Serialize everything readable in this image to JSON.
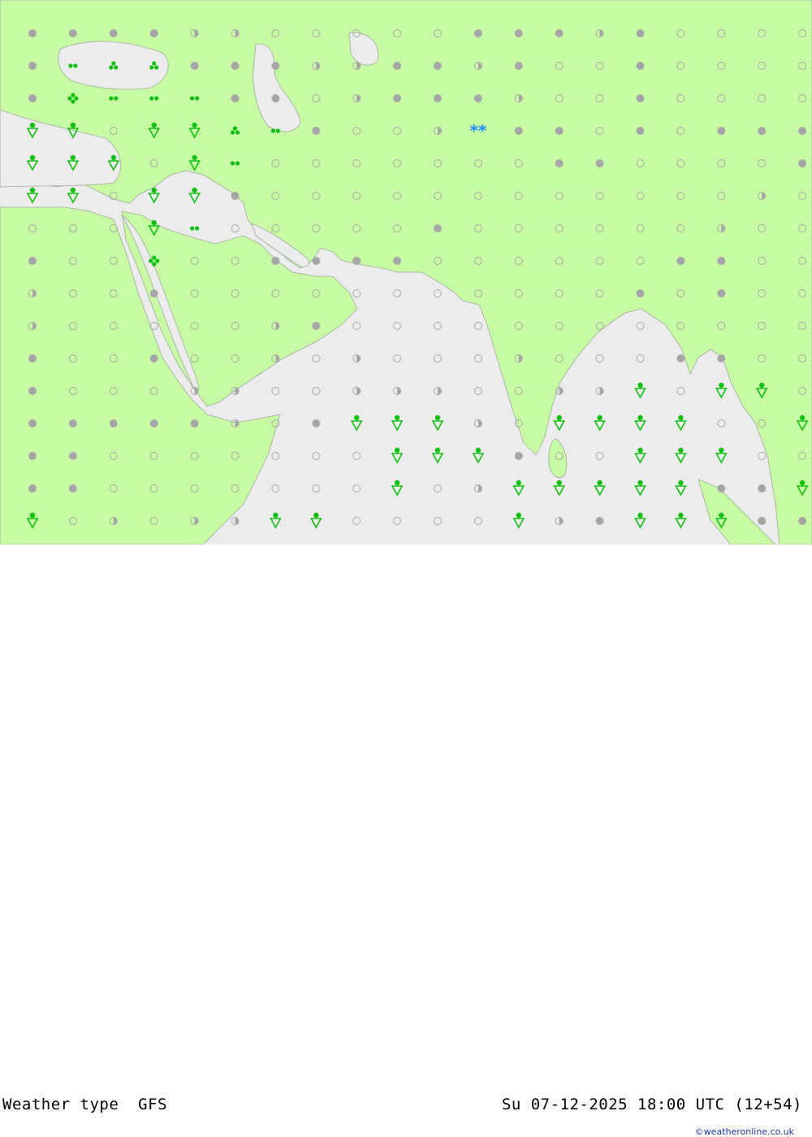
{
  "footer": {
    "title": "Weather type  GFS",
    "timestamp": "Su 07-12-2025 18:00 UTC (12+54)",
    "credit": "©weatheronline.co.uk"
  },
  "colors": {
    "land": "#c8fca4",
    "sea": "#ececec",
    "border": "#9aa89a",
    "dot_gray": "#a6a6a6",
    "rain_green": "#10c010",
    "snow_blue": "#1e90ff"
  },
  "legend_note": "symbols",
  "grid": {
    "rows": [
      "FFFFHHOOOOOFFFHFOOOO",
      "FDDDFFFHHFFHFOOFOOOO",
      "FTTTOFFOHFFFHOOFOOOO",
      "RRORROTFOOHFFFOFOFFF",
      "RRRORTOOOOOOOFFOOOOF",
      "RRORRFOOOOOOOOOOOOHO",
      "OOOOOOOOOOFOOOOOOHOO",
      "FOOHOOFFFFOOOOOOFFOO",
      "HOOFOOOOOOOOOOOFOFOO",
      "HOOOOOHFOOOOOOOOOOOO",
      "FOOFOOHOHOOOHOOOFFOO",
      "FOOOHHOOHHHOOHHRORRO",
      "FFFFFHOFRRRHORRRROOR",
      "FFOOOOOOORRRFOORRROO",
      "FFOOOOOOOROHRRRRRFFR",
      "ROHOHHRROOOORHFRRRFF"
    ],
    "special": [
      {
        "row": 1,
        "col": 1,
        "type": "drizzle-2"
      },
      {
        "row": 1,
        "col": 2,
        "type": "drizzle-3"
      },
      {
        "row": 1,
        "col": 3,
        "type": "drizzle-3"
      },
      {
        "row": 2,
        "col": 1,
        "type": "drizzle-4"
      },
      {
        "row": 2,
        "col": 2,
        "type": "drizzle-2"
      },
      {
        "row": 2,
        "col": 4,
        "type": "drizzle-2"
      },
      {
        "row": 3,
        "col": 5,
        "type": "drizzle-3"
      },
      {
        "row": 3,
        "col": 11,
        "type": "snow"
      },
      {
        "row": 4,
        "col": 5,
        "type": "drizzle-2"
      },
      {
        "row": 6,
        "col": 4,
        "type": "drizzle-2"
      },
      {
        "row": 6,
        "col": 3,
        "type": "rain-shower"
      },
      {
        "row": 7,
        "col": 3,
        "type": "drizzle-4"
      }
    ]
  }
}
